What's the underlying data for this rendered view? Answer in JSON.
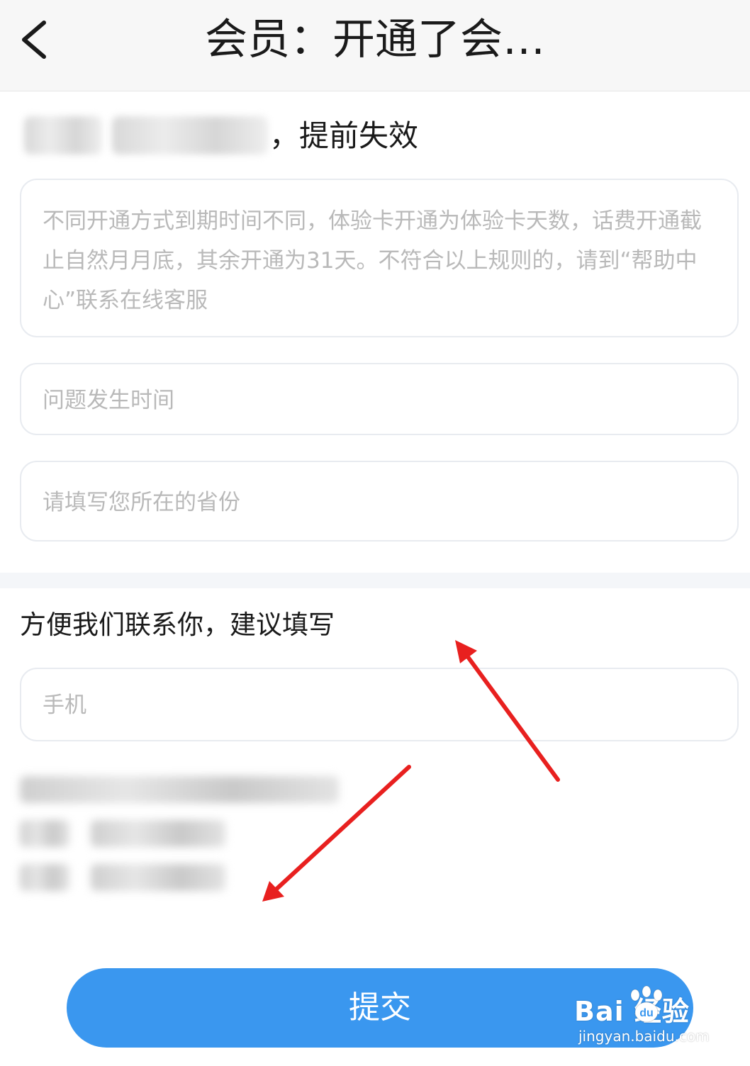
{
  "header": {
    "title": "会员：开通了会…"
  },
  "issue": {
    "suffix": "，提前失效"
  },
  "form": {
    "description_placeholder": "不同开通方式到期时间不同，体验卡开通为体验卡天数，话费开通截止自然月月底，其余开通为31天。不符合以上规则的，请到“帮助中心”联系在线客服",
    "time_placeholder": "问题发生时间",
    "province_placeholder": "请填写您所在的省份"
  },
  "contact": {
    "heading": "方便我们联系你，建议填写",
    "phone_placeholder": "手机"
  },
  "submit": {
    "label": "提交"
  },
  "watermark": {
    "brand": "Bai  经验",
    "url": "jingyan.baidu.com"
  },
  "colors": {
    "accent": "#3a97ef",
    "annotation_arrow": "#e8201f",
    "placeholder": "#b9b9b9"
  }
}
